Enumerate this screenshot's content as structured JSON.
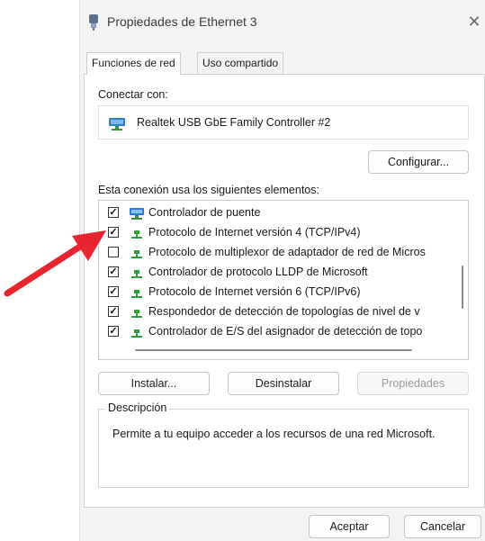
{
  "window": {
    "title": "Propiedades de Ethernet 3",
    "close_symbol": "✕"
  },
  "tabs": [
    {
      "label": "Funciones de red",
      "active": true
    },
    {
      "label": "Uso compartido",
      "active": false
    }
  ],
  "connect_with": {
    "label": "Conectar con:",
    "adapter_name": "Realtek USB GbE Family Controller #2",
    "adapter_icon": "network-adapter-icon"
  },
  "buttons": {
    "configure": "Configurar...",
    "install": "Instalar...",
    "uninstall": "Desinstalar",
    "properties": "Propiedades",
    "accept": "Aceptar",
    "cancel": "Cancelar"
  },
  "items_label": "Esta conexión usa los siguientes elementos:",
  "items": [
    {
      "label": "Controlador de puente",
      "checked": true,
      "icon": "bridge-icon"
    },
    {
      "label": "Protocolo de Internet versión 4 (TCP/IPv4)",
      "checked": true,
      "icon": "protocol-icon"
    },
    {
      "label": "Protocolo de multiplexor de adaptador de red de Micros",
      "checked": false,
      "icon": "protocol-icon"
    },
    {
      "label": "Controlador de protocolo LLDP de Microsoft",
      "checked": true,
      "icon": "protocol-icon"
    },
    {
      "label": "Protocolo de Internet versión 6 (TCP/IPv6)",
      "checked": true,
      "icon": "protocol-icon"
    },
    {
      "label": "Respondedor de detección de topologías de nivel de v",
      "checked": true,
      "icon": "protocol-icon"
    },
    {
      "label": "Controlador de E/S del asignador de detección de topo",
      "checked": true,
      "icon": "protocol-icon"
    }
  ],
  "description": {
    "legend": "Descripción",
    "text": "Permite a tu equipo acceder a los recursos de una red Microsoft."
  },
  "colors": {
    "arrow": "#e8242f",
    "protocol_green": "#2f9e3a",
    "adapter_blue": "#2b7fd1"
  }
}
